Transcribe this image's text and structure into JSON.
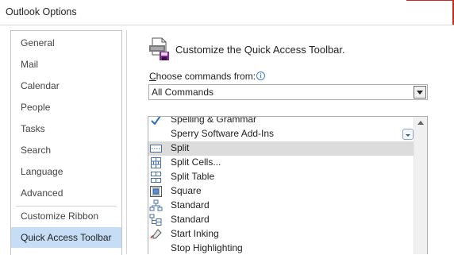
{
  "window": {
    "title": "Outlook Options"
  },
  "nav": {
    "items": [
      {
        "label": "General",
        "selected": false
      },
      {
        "label": "Mail",
        "selected": false
      },
      {
        "label": "Calendar",
        "selected": false
      },
      {
        "label": "People",
        "selected": false
      },
      {
        "label": "Tasks",
        "selected": false
      },
      {
        "label": "Search",
        "selected": false
      },
      {
        "label": "Language",
        "selected": false
      },
      {
        "label": "Advanced",
        "selected": false
      },
      {
        "label": "Customize Ribbon",
        "selected": false
      },
      {
        "label": "Quick Access Toolbar",
        "selected": true
      }
    ]
  },
  "header": {
    "title": "Customize the Quick Access Toolbar."
  },
  "choose": {
    "label_underlined": "C",
    "label_rest": "hoose commands from:",
    "info_icon": "info-icon",
    "selected": "All Commands"
  },
  "commands": [
    {
      "label": "Spelling & Grammar",
      "icon": "checkmark-icon",
      "selected": false
    },
    {
      "label": "Sperry Software Add-Ins",
      "icon": "none",
      "selected": false,
      "has_dropdown": true
    },
    {
      "label": "Split",
      "icon": "split-icon",
      "selected": true
    },
    {
      "label": "Split Cells...",
      "icon": "split-cells-icon",
      "selected": false
    },
    {
      "label": "Split Table",
      "icon": "split-table-icon",
      "selected": false
    },
    {
      "label": "Square",
      "icon": "square-wrap-icon",
      "selected": false
    },
    {
      "label": "Standard",
      "icon": "org-chart-icon",
      "selected": false
    },
    {
      "label": "Standard",
      "icon": "org-chart-icon",
      "selected": false
    },
    {
      "label": "Start Inking",
      "icon": "inking-icon",
      "selected": false
    },
    {
      "label": "Stop Highlighting",
      "icon": "none",
      "selected": false
    }
  ],
  "colors": {
    "selected_nav": "#c5def5",
    "selected_row": "#dcdcdc",
    "accent_red": "#c42b1c"
  }
}
